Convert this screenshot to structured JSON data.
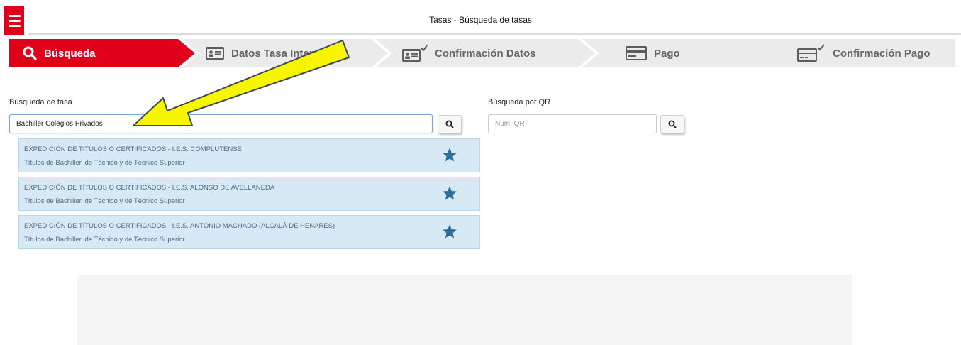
{
  "header": {
    "title": "Tasas - Búsqueda de tasas"
  },
  "steps": [
    {
      "label": "Búsqueda",
      "icon": "search-icon",
      "active": true
    },
    {
      "label": "Datos Tasa Interesado",
      "icon": "id-card-icon",
      "active": false
    },
    {
      "label": "Confirmación Datos",
      "icon": "id-card-check-icon",
      "active": false
    },
    {
      "label": "Pago",
      "icon": "credit-card-icon",
      "active": false
    },
    {
      "label": "Confirmación Pago",
      "icon": "credit-card-check-icon",
      "active": false
    }
  ],
  "search": {
    "label": "Búsqueda de tasa",
    "value": "Bachiller Colegios Privados"
  },
  "qr": {
    "label": "Búsqueda por QR",
    "placeholder": "Num. QR"
  },
  "results": [
    {
      "title": "EXPEDICIÓN DE TÍTULOS O CERTIFICADOS - I.E.S. COMPLUTENSE",
      "subtitle": "Títulos de Bachiller, de Técnico y de Técnico Superior"
    },
    {
      "title": "EXPEDICIÓN DE TÍTULOS O CERTIFICADOS - I.E.S. ALONSO DE AVELLANEDA",
      "subtitle": "Títulos de Bachiller, de Técnico y de Técnico Superior"
    },
    {
      "title": "EXPEDICIÓN DE TÍTULOS O CERTIFICADOS - I.E.S. ANTONIO MACHADO (ALCALÁ DE HENARES)",
      "subtitle": "Títulos de Bachiller, de Técnico y de Técnico Superior"
    }
  ],
  "colors": {
    "accent": "#e1001a",
    "step_inactive": "#ebebeb",
    "result_bg": "#d7e9f4",
    "star": "#2f6e9a",
    "annotation_arrow": "#f7f500"
  }
}
